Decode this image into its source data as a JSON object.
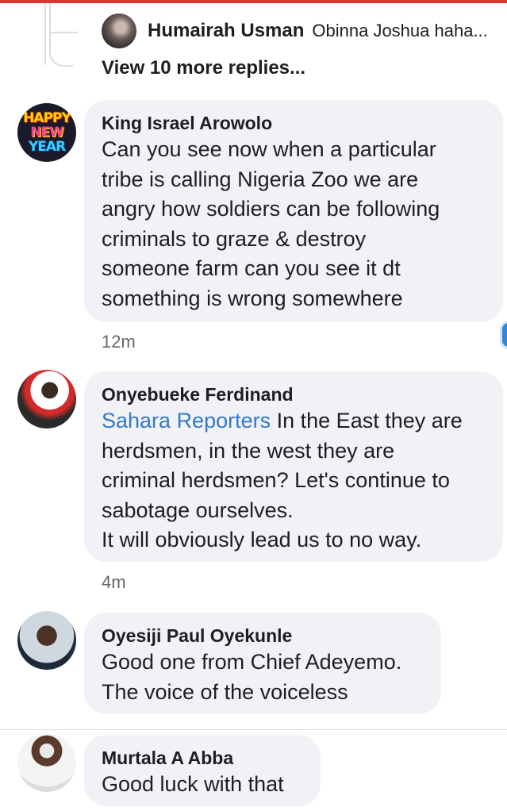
{
  "reply_preview": {
    "name": "Humairah Usman",
    "snippet": "Obinna Joshua haha..."
  },
  "view_more": "View 10 more replies...",
  "comments": [
    {
      "author": "King Israel Arowolo",
      "avatar_text": [
        "HAPPY",
        "NEW",
        "YEAR"
      ],
      "text_lines": [
        "Can you see now when a particular",
        "tribe is calling Nigeria Zoo we are",
        "angry how soldiers can be following",
        "criminals to graze & destroy",
        "someone farm can you see it dt",
        "something is wrong somewhere"
      ],
      "time": "12m"
    },
    {
      "author": "Onyebueke Ferdinand",
      "mention": "Sahara Reporters",
      "first_line_rest": " In the East they are",
      "text_lines": [
        "herdsmen, in the west they are",
        "criminal herdsmen? Let's continue to",
        "sabotage ourselves.",
        "It will obviously lead us to no way."
      ],
      "time": "4m"
    },
    {
      "author": "Oyesiji Paul Oyekunle",
      "text_lines": [
        "Good one from Chief Adeyemo.",
        "The voice of the voiceless"
      ]
    },
    {
      "author": "Murtala A Abba",
      "text_lines": [
        "Good luck with that"
      ]
    }
  ],
  "colors": {
    "bubble": "#f0f2f5",
    "mention": "#3578c8",
    "top_accent": "#e0322f"
  }
}
